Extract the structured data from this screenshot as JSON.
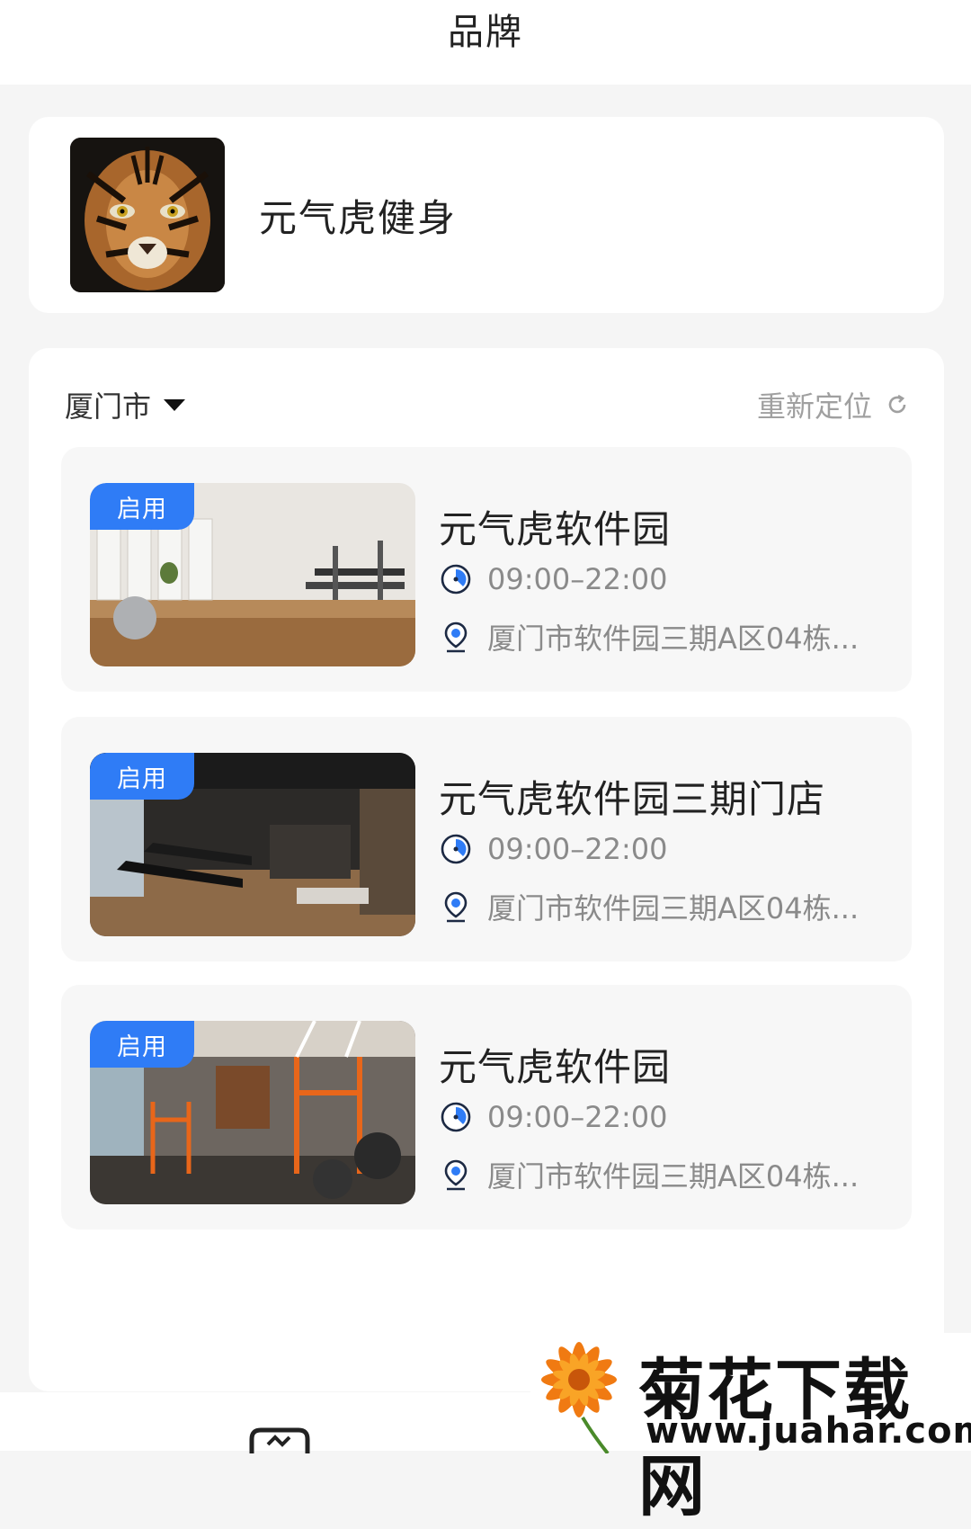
{
  "header": {
    "title": "品牌"
  },
  "brand": {
    "name": "元气虎健身",
    "logo_icon": "tiger-logo"
  },
  "location": {
    "city": "厦门市",
    "relocate_label": "重新定位"
  },
  "stores": [
    {
      "badge": "启用",
      "name": "元气虎软件园",
      "hours": "09:00–22:00",
      "address": "厦门市软件园三期A区04栋..."
    },
    {
      "badge": "启用",
      "name": "元气虎软件园三期门店",
      "hours": "09:00–22:00",
      "address": "厦门市软件园三期A区04栋..."
    },
    {
      "badge": "启用",
      "name": "元气虎软件园",
      "hours": "09:00–22:00",
      "address": "厦门市软件园三期A区04栋..."
    }
  ],
  "watermark": {
    "title": "菊花下载网",
    "url": "www.juahar.com"
  },
  "colors": {
    "accent": "#2f7cf6",
    "background": "#f5f5f5",
    "card": "#ffffff"
  }
}
